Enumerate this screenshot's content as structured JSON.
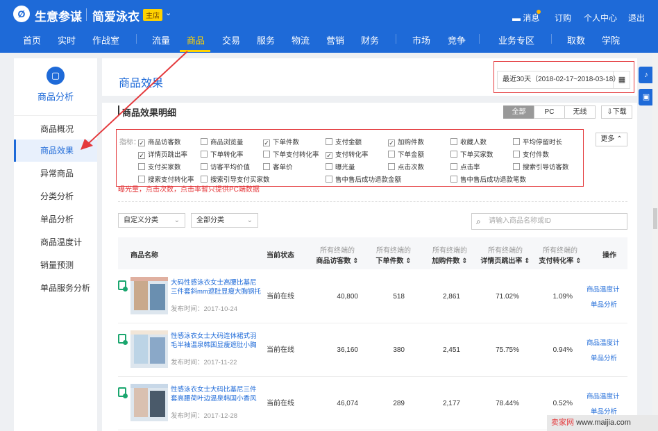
{
  "header": {
    "logo_glyph": "Ø",
    "brand": "生意参谋",
    "shop": "简爱泳衣",
    "shop_badge": "主店",
    "links": [
      "消息",
      "订购",
      "个人中心",
      "退出"
    ]
  },
  "nav": [
    "首页",
    "实时",
    "作战室",
    "流量",
    "商品",
    "交易",
    "服务",
    "物流",
    "营销",
    "财务",
    "市场",
    "竞争",
    "业务专区",
    "取数",
    "学院"
  ],
  "sidebar": {
    "title": "商品分析",
    "icon": "bag-icon",
    "items": [
      "商品概况",
      "商品效果",
      "异常商品",
      "分类分析",
      "单品分析",
      "商品温度计",
      "销量预测",
      "单品服务分析"
    ],
    "active": 1
  },
  "main": {
    "title": "商品效果",
    "date_range": "最近30天（2018-02-17~2018-03-18）",
    "section_title": "商品效果明细",
    "device_tabs": [
      "全部",
      "PC",
      "无线"
    ],
    "download": "下载",
    "metrics_label": "指标：",
    "more": "更多",
    "metrics": [
      [
        "商品访客数",
        "商品浏览量",
        "下单件数",
        "支付金额",
        "加购件数",
        "收藏人数",
        "平均停留时长"
      ],
      [
        "详情页跳出率",
        "下单转化率",
        "下单支付转化率",
        "支付转化率",
        "下单金额",
        "下单买家数",
        "支付件数"
      ],
      [
        "支付买家数",
        "访客平均价值",
        "客单价",
        "曝光量",
        "点击次数",
        "点击率",
        "搜索引导访客数"
      ],
      [
        "搜索支付转化率",
        "搜索引导支付买家数",
        "",
        "售中售后成功退款金额",
        "",
        "售中售后成功退款笔数",
        ""
      ]
    ],
    "checked": [
      [
        true,
        false,
        true,
        false,
        true,
        false,
        false
      ],
      [
        true,
        false,
        false,
        true,
        false,
        false,
        false
      ],
      [
        false,
        false,
        false,
        false,
        false,
        false,
        false
      ],
      [
        false,
        false,
        false,
        false,
        false,
        false,
        false
      ]
    ],
    "warning": "曝光量，点击次数，点击率暂只提供PC端数据",
    "filters": [
      "自定义分类",
      "全部分类"
    ],
    "search_placeholder": "请输入商品名称或ID",
    "columns": {
      "name": "商品名称",
      "status": "当前状态",
      "all": "所有终端的",
      "c1": "商品访客数",
      "c2": "下单件数",
      "c3": "加购件数",
      "c4": "详情页跳出率",
      "c5": "支付转化率",
      "ops": "操作"
    },
    "products": [
      {
        "name": "大码性感泳衣女士高腰比基尼三件套斜mm遮肚显瘦大胸钢托聚",
        "date": "发布时间：2017-10-24",
        "status": "当前在线",
        "visitors": "40,800",
        "orders": "518",
        "cart": "2,861",
        "bounce": "71.02%",
        "conv": "1.09%",
        "op1": "商品温度计",
        "op2": "单品分析"
      },
      {
        "name": "性感泳衣女士大码连体裙式羽毛半袖温泉韩国显瘦遮肚小胸聚拢",
        "date": "发布时间：2017-11-22",
        "status": "当前在线",
        "visitors": "36,160",
        "orders": "380",
        "cart": "2,451",
        "bounce": "75.75%",
        "conv": "0.94%",
        "op1": "商品温度计",
        "op2": "单品分析"
      },
      {
        "name": "性感泳衣女士大码比基尼三件套高腰荷叶边温泉韩国小香风聚拢",
        "date": "发布时间：2017-12-28",
        "status": "当前在线",
        "visitors": "46,074",
        "orders": "289",
        "cart": "2,177",
        "bounce": "78.44%",
        "conv": "0.52%",
        "op1": "商品温度计",
        "op2": "单品分析"
      }
    ]
  },
  "watermark": {
    "a": "卖家网",
    "b": "www.maijia.com"
  },
  "colors": {
    "header": "#1e6ad8",
    "accent": "#ffd200",
    "highlight": "#e4393c"
  }
}
